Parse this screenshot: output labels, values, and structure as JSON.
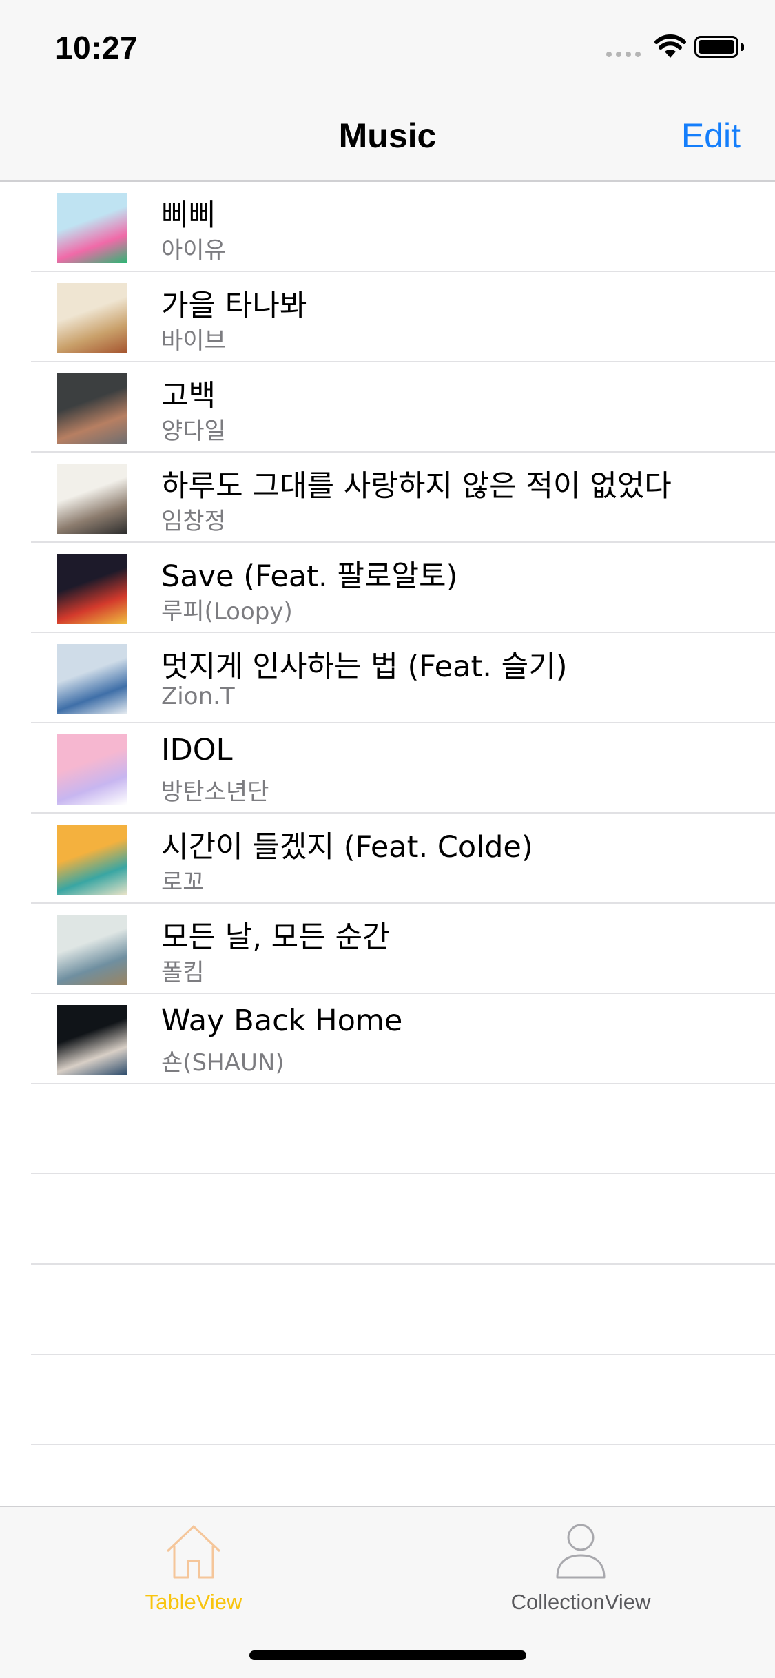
{
  "status_bar": {
    "time": "10:27"
  },
  "nav": {
    "title": "Music",
    "edit_label": "Edit"
  },
  "songs": [
    {
      "title": "삐삐",
      "artist": "아이유",
      "art_colors": [
        "#bfe3f2",
        "#f06aa8",
        "#2bb673"
      ]
    },
    {
      "title": "가을 타나봐",
      "artist": "바이브",
      "art_colors": [
        "#efe5d2",
        "#c9a06a",
        "#a4532e"
      ]
    },
    {
      "title": "고백",
      "artist": "양다일",
      "art_colors": [
        "#3c3f40",
        "#b77f62",
        "#6e6e70"
      ]
    },
    {
      "title": "하루도 그대를 사랑하지 않은 적이 없었다",
      "artist": "임창정",
      "art_colors": [
        "#f2f0ea",
        "#8c7c6e",
        "#2d2d2d"
      ]
    },
    {
      "title": "Save (Feat. 팔로알토)",
      "artist": "루피(Loopy)",
      "art_colors": [
        "#1d1a2a",
        "#d33a2c",
        "#f0c040"
      ]
    },
    {
      "title": "멋지게 인사하는 법 (Feat. 슬기)",
      "artist": "Zion.T",
      "art_colors": [
        "#cfdce8",
        "#3f6fa8",
        "#e9eef2"
      ]
    },
    {
      "title": "IDOL",
      "artist": "방탄소년단",
      "art_colors": [
        "#f6b7d0",
        "#c7b6f0",
        "#ffffff"
      ]
    },
    {
      "title": "시간이 들겠지 (Feat. Colde)",
      "artist": "로꼬",
      "art_colors": [
        "#f4b13e",
        "#39a6a3",
        "#e9e3c7"
      ]
    },
    {
      "title": "모든 날, 모든 순간",
      "artist": "폴킴",
      "art_colors": [
        "#dfe6e4",
        "#6f8fa0",
        "#9b8460"
      ]
    },
    {
      "title": "Way Back Home",
      "artist": "숀(SHAUN)",
      "art_colors": [
        "#101418",
        "#d8cfc6",
        "#2a4a6a"
      ]
    }
  ],
  "empty_rows": 5,
  "tabs": [
    {
      "label": "TableView",
      "icon": "house-icon",
      "color": "#f8c40e",
      "selected": true
    },
    {
      "label": "CollectionView",
      "icon": "person-icon",
      "color": "#8e8e93",
      "selected": false
    }
  ],
  "colors": {
    "accent": "#147efb",
    "separator": "#e1e1e4",
    "bar_background": "#f7f7f7"
  }
}
